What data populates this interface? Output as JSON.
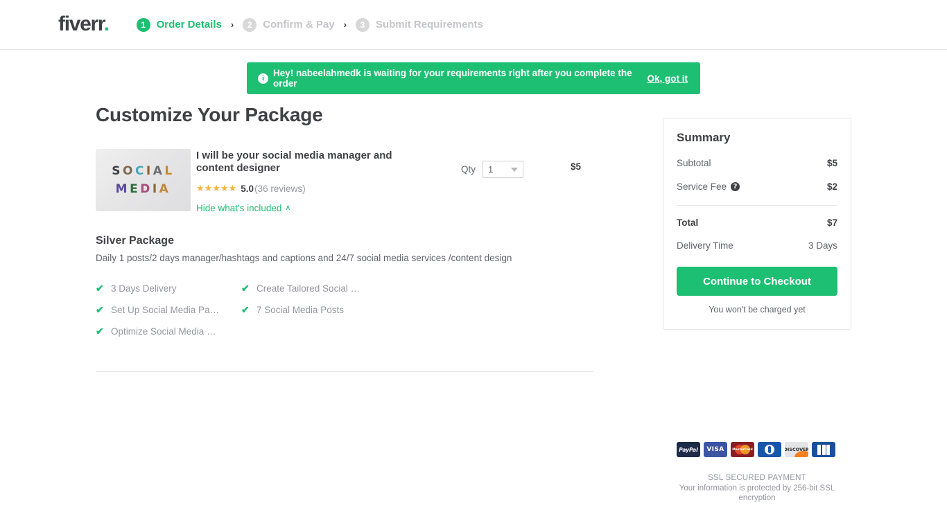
{
  "header": {
    "logo_text": "fiverr",
    "logo_dot": ".",
    "steps": [
      {
        "num": "1",
        "label": "Order Details",
        "state": "active"
      },
      {
        "num": "2",
        "label": "Confirm & Pay",
        "state": "inactive"
      },
      {
        "num": "3",
        "label": "Submit Requirements",
        "state": "inactive"
      }
    ],
    "separator": "›"
  },
  "notice": {
    "info_glyph": "i",
    "message": "Hey! nabeelahmedk is waiting for your requirements right after you complete the order",
    "action_label": "Ok, got it",
    "color": "#1dbf73"
  },
  "main": {
    "page_title": "Customize Your Package",
    "thumbnail": {
      "line1": "SOCIAL",
      "line2": "MEDIA",
      "line1_colors": [
        "#3f4046",
        "#7e6a52",
        "#4aa5b8",
        "#8f5f33",
        "#6e6e72",
        "#c28a2e"
      ],
      "line2_colors": [
        "#5b4a9e",
        "#2f6f3c",
        "#a34f7d",
        "#8a6a33",
        "#c0873d"
      ]
    },
    "gig_title": "I will be your social media manager and content designer",
    "rating": {
      "stars": "★★★★★",
      "score": "5.0",
      "count": "(36 reviews)"
    },
    "hide_included_label": "Hide what's included",
    "hide_included_chevron": "∧",
    "qty_label": "Qty",
    "qty_value": "1",
    "gig_price": "$5",
    "package": {
      "name": "Silver Package",
      "description": "Daily 1 posts/2 days manager/hashtags and captions and 24/7 social media services /content design",
      "features": [
        {
          "tick": "✔",
          "text": "3 Days Delivery"
        },
        {
          "tick": "✔",
          "text": "Create Tailored Social …"
        },
        {
          "tick": "✔",
          "text": "Set Up Social Media Pa…"
        },
        {
          "tick": "✔",
          "text": "7 Social Media Posts"
        },
        {
          "tick": "✔",
          "text": "Optimize Social Media …"
        }
      ]
    }
  },
  "summary": {
    "title": "Summary",
    "subtotal_label": "Subtotal",
    "subtotal_value": "$5",
    "service_fee_label": "Service Fee",
    "service_fee_help": "?",
    "service_fee_value": "$2",
    "total_label": "Total",
    "total_value": "$7",
    "delivery_label": "Delivery Time",
    "delivery_value": "3 Days",
    "checkout_label": "Continue to Checkout",
    "charge_note": "You won't be charged yet"
  },
  "payment": {
    "methods": [
      {
        "name": "PayPal",
        "label": "PayPal",
        "class": "pay-paypal"
      },
      {
        "name": "Visa",
        "label": "VISA",
        "class": "pay-visa"
      },
      {
        "name": "Mastercard",
        "label": "MasterCard",
        "class": "pay-mc"
      },
      {
        "name": "Diners Club",
        "label": "",
        "class": "pay-diners"
      },
      {
        "name": "Discover",
        "label": "DISCOVER",
        "class": "pay-discover"
      },
      {
        "name": "JCB",
        "label": "JCB",
        "class": "pay-jcb"
      }
    ],
    "ssl_title": "SSL SECURED PAYMENT",
    "ssl_sub": "Your information is protected by 256-bit SSL encryption"
  }
}
